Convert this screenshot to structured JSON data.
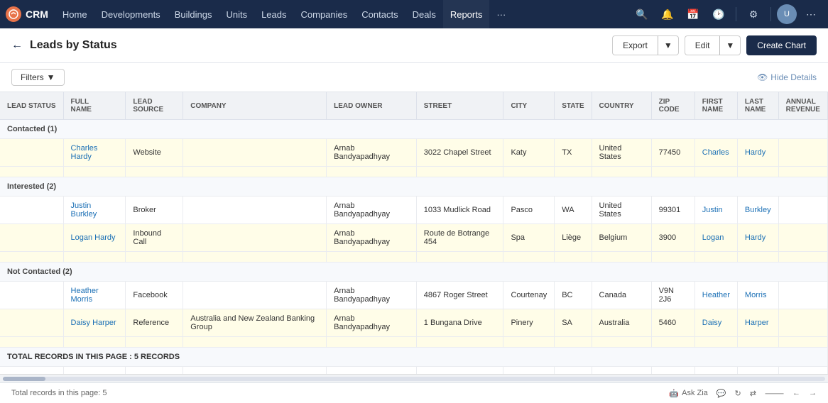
{
  "nav": {
    "logo_text": "CRM",
    "items": [
      {
        "label": "Home",
        "active": false
      },
      {
        "label": "Developments",
        "active": false
      },
      {
        "label": "Buildings",
        "active": false
      },
      {
        "label": "Units",
        "active": false
      },
      {
        "label": "Leads",
        "active": false
      },
      {
        "label": "Companies",
        "active": false
      },
      {
        "label": "Contacts",
        "active": false
      },
      {
        "label": "Deals",
        "active": false
      },
      {
        "label": "Reports",
        "active": true
      },
      {
        "label": "···",
        "active": false
      }
    ]
  },
  "header": {
    "title": "Leads by Status",
    "export_label": "Export",
    "edit_label": "Edit",
    "create_chart_label": "Create Chart"
  },
  "toolbar": {
    "filters_label": "Filters",
    "hide_details_label": "Hide Details"
  },
  "table": {
    "columns": [
      {
        "key": "lead_status",
        "label": "LEAD STATUS"
      },
      {
        "key": "full_name",
        "label": "FULL NAME"
      },
      {
        "key": "lead_source",
        "label": "LEAD SOURCE"
      },
      {
        "key": "company",
        "label": "COMPANY"
      },
      {
        "key": "lead_owner",
        "label": "LEAD OWNER"
      },
      {
        "key": "street",
        "label": "STREET"
      },
      {
        "key": "city",
        "label": "CITY"
      },
      {
        "key": "state",
        "label": "STATE"
      },
      {
        "key": "country",
        "label": "COUNTRY"
      },
      {
        "key": "zip_code",
        "label": "ZIP CODE"
      },
      {
        "key": "first_name",
        "label": "FIRST NAME"
      },
      {
        "key": "last_name",
        "label": "LAST NAME"
      },
      {
        "key": "annual_revenue",
        "label": "ANNUAL REVENUE"
      }
    ],
    "groups": [
      {
        "group_label": "Contacted (1)",
        "rows": [
          {
            "full_name": "Charles Hardy",
            "lead_source": "Website",
            "company": "",
            "lead_owner": "Arnab Bandyapadhyay",
            "street": "3022 Chapel Street",
            "city": "Katy",
            "state": "TX",
            "country": "United States",
            "zip_code": "77450",
            "first_name": "Charles",
            "last_name": "Hardy",
            "annual_revenue": "",
            "yellow": true
          }
        ]
      },
      {
        "group_label": "Interested (2)",
        "rows": [
          {
            "full_name": "Justin Burkley",
            "lead_source": "Broker",
            "company": "",
            "lead_owner": "Arnab Bandyapadhyay",
            "street": "1033 Mudlick Road",
            "city": "Pasco",
            "state": "WA",
            "country": "United States",
            "zip_code": "99301",
            "first_name": "Justin",
            "last_name": "Burkley",
            "annual_revenue": "",
            "yellow": false
          },
          {
            "full_name": "Logan Hardy",
            "lead_source": "Inbound Call",
            "company": "",
            "lead_owner": "Arnab Bandyapadhyay",
            "street": "Route de Botrange 454",
            "city": "Spa",
            "state": "Liège",
            "country": "Belgium",
            "zip_code": "3900",
            "first_name": "Logan",
            "last_name": "Hardy",
            "annual_revenue": "",
            "yellow": true
          }
        ]
      },
      {
        "group_label": "Not Contacted (2)",
        "rows": [
          {
            "full_name": "Heather Morris",
            "lead_source": "Facebook",
            "company": "",
            "lead_owner": "Arnab Bandyapadhyay",
            "street": "4867 Roger Street",
            "city": "Courtenay",
            "state": "BC",
            "country": "Canada",
            "zip_code": "V9N 2J6",
            "first_name": "Heather",
            "last_name": "Morris",
            "annual_revenue": "",
            "yellow": false
          },
          {
            "full_name": "Daisy Harper",
            "lead_source": "Reference",
            "company": "Australia and New Zealand Banking Group",
            "lead_owner": "Arnab Bandyapadhyay",
            "street": "1 Bungana Drive",
            "city": "Pinery",
            "state": "SA",
            "country": "Australia",
            "zip_code": "5460",
            "first_name": "Daisy",
            "last_name": "Harper",
            "annual_revenue": "",
            "yellow": true
          }
        ]
      }
    ],
    "total_label": "TOTAL RECORDS IN THIS PAGE : 5 RECORDS"
  },
  "bottom": {
    "total_records": "Total records in this page: 5",
    "ask_zia": "Ask Zia",
    "icons": [
      "chat-icon",
      "refresh-icon",
      "share-icon",
      "bookmark-icon",
      "back-icon",
      "forward-icon"
    ]
  }
}
